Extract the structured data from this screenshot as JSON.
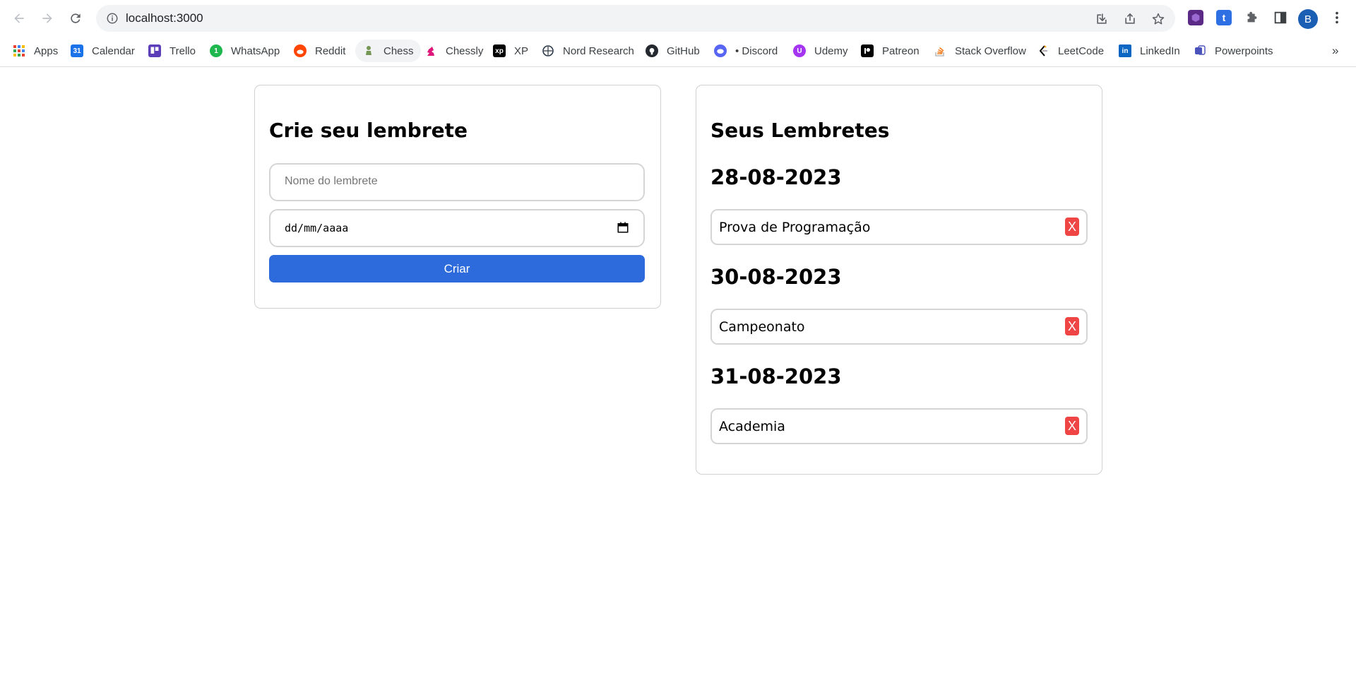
{
  "browser": {
    "url": "localhost:3000",
    "profile_initial": "B",
    "more_bookmarks": "»"
  },
  "bookmarks": [
    {
      "label": "Apps",
      "icon": "apps-grid-icon"
    },
    {
      "label": "Calendar",
      "icon": "calendar-icon",
      "badge": "31"
    },
    {
      "label": "Trello",
      "icon": "trello-icon"
    },
    {
      "label": "WhatsApp",
      "icon": "whatsapp-icon",
      "badge": "1"
    },
    {
      "label": "Reddit",
      "icon": "reddit-icon"
    },
    {
      "label": "Chess",
      "icon": "chess-pawn-icon"
    },
    {
      "label": "Chessly",
      "icon": "chessly-knight-icon"
    },
    {
      "label": "XP",
      "icon": "xp-icon",
      "badge": "xp"
    },
    {
      "label": "Nord Research",
      "icon": "nord-research-icon"
    },
    {
      "label": "GitHub",
      "icon": "github-icon"
    },
    {
      "label": "• Discord",
      "icon": "discord-icon"
    },
    {
      "label": "Udemy",
      "icon": "udemy-icon"
    },
    {
      "label": "Patreon",
      "icon": "patreon-icon"
    },
    {
      "label": "Stack Overflow",
      "icon": "stackoverflow-icon"
    },
    {
      "label": "LeetCode",
      "icon": "leetcode-icon"
    },
    {
      "label": "LinkedIn",
      "icon": "linkedin-icon",
      "badge": "in"
    },
    {
      "label": "Powerpoints",
      "icon": "powerpoint-icon"
    }
  ],
  "create": {
    "title": "Crie seu lembrete",
    "name_placeholder": "Nome do lembrete",
    "date_placeholder": "dd/mm/aaaa",
    "submit_label": "Criar"
  },
  "list": {
    "title": "Seus Lembretes",
    "delete_label": "X",
    "groups": [
      {
        "date": "28-08-2023",
        "items": [
          "Prova de Programação"
        ]
      },
      {
        "date": "30-08-2023",
        "items": [
          "Campeonato"
        ]
      },
      {
        "date": "31-08-2023",
        "items": [
          "Academia"
        ]
      }
    ]
  },
  "colors": {
    "primary_button": "#2d6bdc",
    "delete_button": "#ef4545",
    "card_border": "#d0d0d0"
  }
}
